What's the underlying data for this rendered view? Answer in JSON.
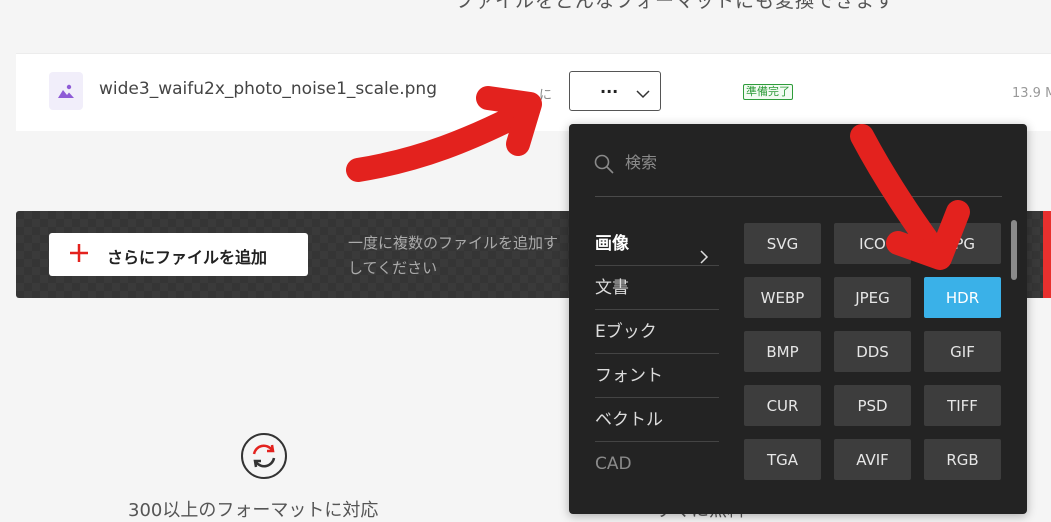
{
  "header": {
    "heading": "ファイルをどんなフォーマットにも変換できます"
  },
  "file": {
    "name": "wide3_waifu2x_photo_noise1_scale.png",
    "to_label": "に",
    "selected_format": "...",
    "status": "準備完了",
    "size": "13.9 M"
  },
  "add_bar": {
    "button_label": "さらにファイルを追加",
    "hint": "一度に複数のファイルを追加する場合は、ファイルをドロップしてください",
    "hint_line1": "一度に複数のファイルを追加す",
    "hint_line2": "してください"
  },
  "dropdown": {
    "search_placeholder": "検索",
    "categories": [
      {
        "label": "画像",
        "active": true
      },
      {
        "label": "文書"
      },
      {
        "label": "Eブック"
      },
      {
        "label": "フォント"
      },
      {
        "label": "ベクトル"
      },
      {
        "label": "CAD"
      }
    ],
    "formats": [
      "SVG",
      "ICO",
      "JPG",
      "WEBP",
      "JPEG",
      "HDR",
      "BMP",
      "DDS",
      "GIF",
      "CUR",
      "PSD",
      "TIFF",
      "TGA",
      "AVIF",
      "RGB"
    ],
    "selected_format": "HDR"
  },
  "features": {
    "formats_caption": "300以上のフォーマットに対応",
    "right_caption": "すぐに無料"
  },
  "colors": {
    "accent_blue": "#3ab1e8",
    "annotation_red": "#e3221e",
    "status_green": "#2e9c3a",
    "dropdown_bg": "#232323"
  },
  "icons": [
    "image-file-icon",
    "chevron-down-icon",
    "plus-icon",
    "search-icon",
    "chevron-right-icon",
    "sync-icon"
  ]
}
